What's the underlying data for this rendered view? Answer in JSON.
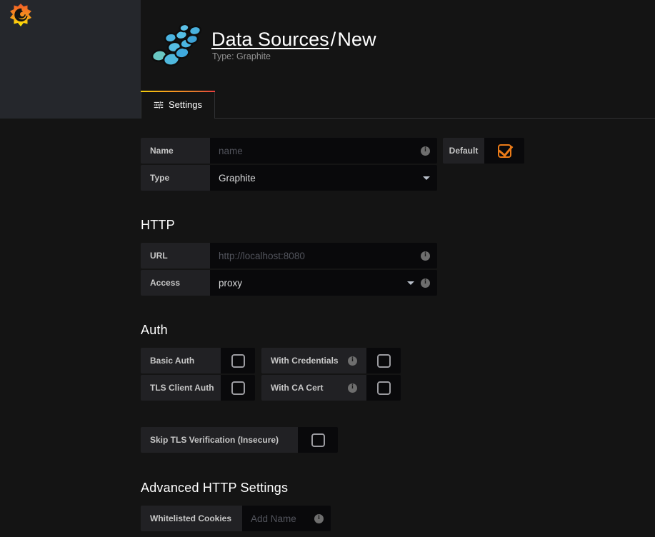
{
  "brand": {
    "logo_icon": "grafana-flame-icon"
  },
  "header": {
    "datasource_logo_icon": "graphite-nodes-icon",
    "breadcrumb_link": "Data Sources",
    "breadcrumb_separator": "/",
    "breadcrumb_current": "New",
    "subtitle": "Type: Graphite"
  },
  "tabs": [
    {
      "label": "Settings",
      "icon": "sliders-icon",
      "active": true
    }
  ],
  "form": {
    "name": {
      "label": "Name",
      "value": "",
      "placeholder": "name",
      "info_icon": "info-icon"
    },
    "default": {
      "label": "Default",
      "checked": true
    },
    "type": {
      "label": "Type",
      "value": "Graphite",
      "caret_icon": "chevron-down-icon"
    }
  },
  "http": {
    "title": "HTTP",
    "url": {
      "label": "URL",
      "value": "",
      "placeholder": "http://localhost:8080",
      "info_icon": "info-icon"
    },
    "access": {
      "label": "Access",
      "value": "proxy",
      "caret_icon": "chevron-down-icon",
      "info_icon": "info-icon"
    }
  },
  "auth": {
    "title": "Auth",
    "basic_auth": {
      "label": "Basic Auth",
      "checked": false
    },
    "with_credentials": {
      "label": "With Credentials",
      "checked": false,
      "info_icon": "info-icon"
    },
    "tls_client_auth": {
      "label": "TLS Client Auth",
      "checked": false
    },
    "with_ca_cert": {
      "label": "With CA Cert",
      "checked": false,
      "info_icon": "info-icon"
    },
    "skip_tls_verification": {
      "label": "Skip TLS Verification (Insecure)",
      "checked": false
    }
  },
  "advanced": {
    "title": "Advanced HTTP Settings",
    "whitelisted_cookies": {
      "label": "Whitelisted Cookies",
      "value": "",
      "placeholder": "Add Name",
      "info_icon": "info-icon"
    }
  },
  "colors": {
    "accent_orange": "#eb7b18",
    "page_bg": "#141414",
    "panel_bg": "#25272c",
    "label_bg": "#212124",
    "input_bg": "#09090b"
  }
}
